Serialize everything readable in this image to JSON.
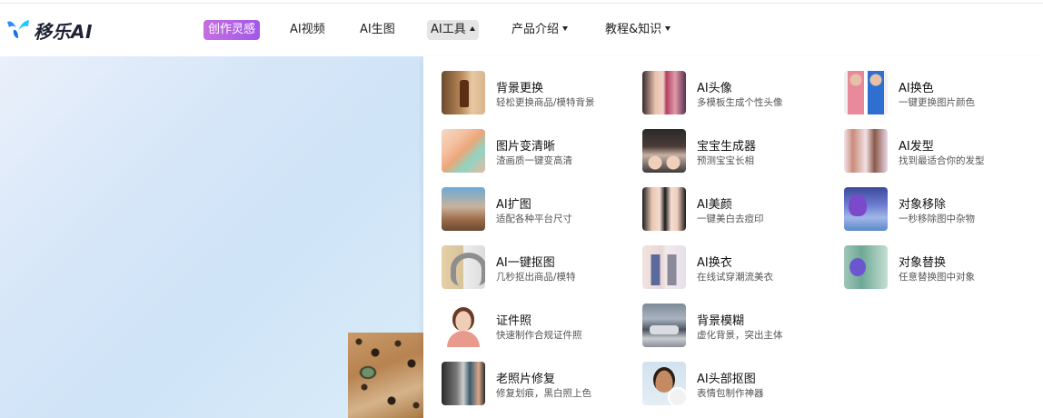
{
  "header": {
    "logo_text": "移乐AI",
    "nav": [
      {
        "label": "创作灵感",
        "style": "highlight"
      },
      {
        "label": "AI视频"
      },
      {
        "label": "AI生图"
      },
      {
        "label": "AI工具",
        "active": true,
        "caret": "up"
      },
      {
        "label": "产品介绍",
        "caret": "down"
      },
      {
        "label": "教程&知识",
        "caret": "down"
      }
    ]
  },
  "colors": {
    "highlight": "#b266e6",
    "logo_blue": "#1fa3ff",
    "hero_bg": "#d4e7f8"
  },
  "tools": [
    {
      "title": "背景更换",
      "desc": "轻松更换商品/模特背景"
    },
    {
      "title": "AI头像",
      "desc": "多模板生成个性头像"
    },
    {
      "title": "AI换色",
      "desc": "一键更换图片颜色"
    },
    {
      "title": "图片变清晰",
      "desc": "渣画质一键变高清"
    },
    {
      "title": "宝宝生成器",
      "desc": "预测宝宝长相"
    },
    {
      "title": "AI发型",
      "desc": "找到最适合你的发型"
    },
    {
      "title": "AI扩图",
      "desc": "适配各种平台尺寸"
    },
    {
      "title": "AI美颜",
      "desc": "一键美白去痘印"
    },
    {
      "title": "对象移除",
      "desc": "一秒移除图中杂物"
    },
    {
      "title": "AI一键抠图",
      "desc": "几秒抠出商品/模特"
    },
    {
      "title": "AI换衣",
      "desc": "在线试穿潮流美衣"
    },
    {
      "title": "对象替换",
      "desc": "任意替换图中对象"
    },
    {
      "title": "证件照",
      "desc": "快速制作合规证件照"
    },
    {
      "title": "背景模糊",
      "desc": "虚化背景，突出主体"
    },
    {
      "title": "老照片修复",
      "desc": "修复划痕，黑白照上色"
    },
    {
      "title": "AI头部抠图",
      "desc": "表情包制作神器"
    }
  ]
}
